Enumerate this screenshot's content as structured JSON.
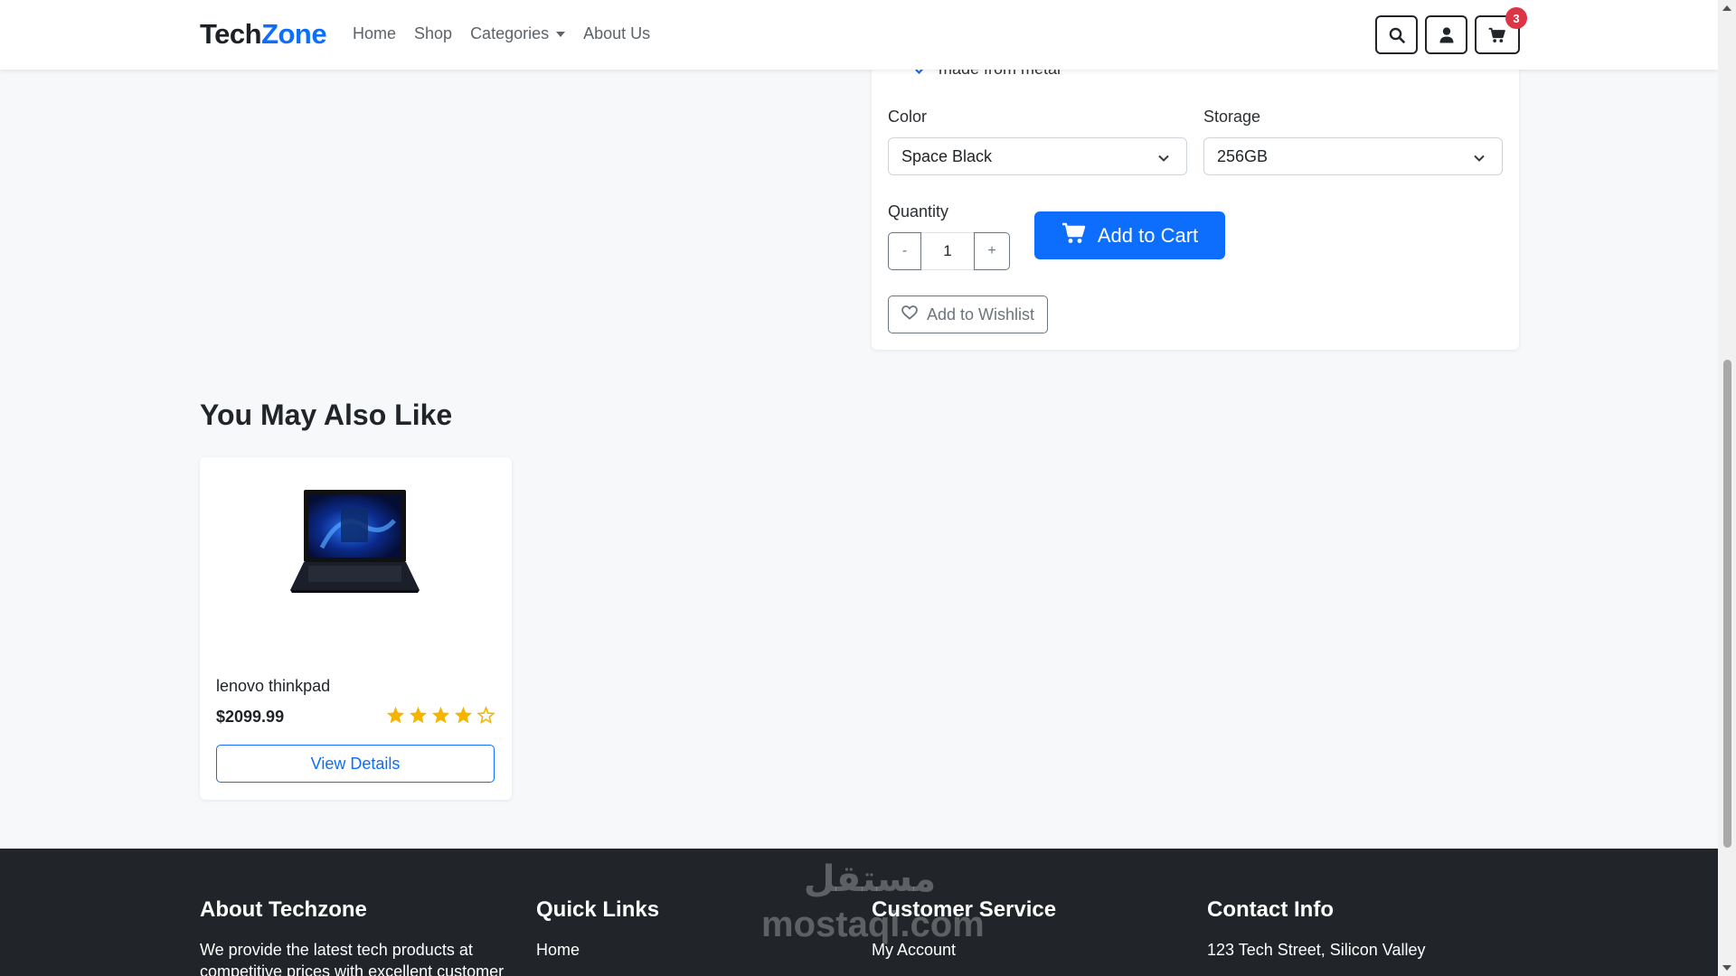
{
  "brand": {
    "part1": "Tech",
    "part2": "Zone"
  },
  "nav": {
    "items": [
      "Home",
      "Shop",
      "Categories",
      "About Us"
    ],
    "cart_count": "3"
  },
  "product": {
    "feature_partial": "made from metal",
    "color_label": "Color",
    "color_value": "Space Black",
    "storage_label": "Storage",
    "storage_value": "256GB",
    "quantity_label": "Quantity",
    "quantity_value": "1",
    "minus_label": "-",
    "plus_label": "+",
    "add_to_cart_label": "Add to Cart",
    "wishlist_label": "Add to Wishlist"
  },
  "related": {
    "title": "You May Also Like",
    "items": [
      {
        "name": "lenovo thinkpad",
        "price": "$2099.99",
        "rating": 4,
        "rating_max": 5,
        "button": "View Details"
      }
    ]
  },
  "footer": {
    "about_title": "About Techzone",
    "about_text_1": "We provide the latest tech products at",
    "about_text_2": "competitive prices with excellent customer",
    "quick_title": "Quick Links",
    "quick_first": "Home",
    "service_title": "Customer Service",
    "service_first": "My Account",
    "contact_title": "Contact Info",
    "contact_first": "123 Tech Street, Silicon Valley"
  },
  "watermark": {
    "line1": "مستقل",
    "line2": "mostaql.com"
  },
  "colors": {
    "primary": "#0d6efd",
    "dark": "#212529",
    "badge": "#dc3545",
    "star": "#f5b400"
  }
}
